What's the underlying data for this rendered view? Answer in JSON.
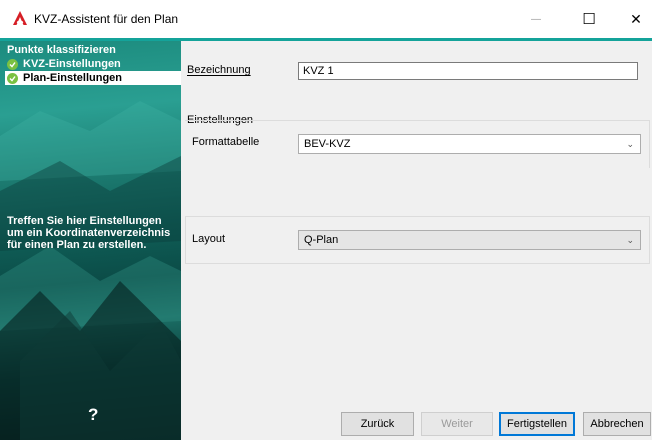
{
  "window": {
    "title": "KVZ-Assistent für den Plan",
    "minimize_glyph": "—",
    "maximize_glyph": "☐",
    "close_glyph": "✕",
    "accent_color": "#14a39a"
  },
  "wizard": {
    "steps_header": "Punkte klassifizieren",
    "steps": [
      {
        "label": "KVZ-Einstellungen",
        "done": true,
        "active": false
      },
      {
        "label": "Plan-Einstellungen",
        "done": true,
        "active": true
      }
    ],
    "hint": "Treffen Sie hier Einstellungen um ein Koordinatenverzeichnis für einen Plan zu erstellen.",
    "help_glyph": "?"
  },
  "form": {
    "bezeichnung_label": "Bezeichnung",
    "bezeichnung_value": "KVZ 1",
    "einstellungen_label": "Einstellungen",
    "formattabelle_label": "Formattabelle",
    "formattabelle_value": "BEV-KVZ",
    "layout_label": "Layout",
    "layout_value": "Q-Plan"
  },
  "buttons": {
    "back": "Zurück",
    "next": "Weiter",
    "finish": "Fertigstellen",
    "cancel": "Abbrechen"
  },
  "icons": {
    "app": "autocad-a-icon",
    "check": "check-circle-icon",
    "dropdown": "chevron-down-icon"
  }
}
